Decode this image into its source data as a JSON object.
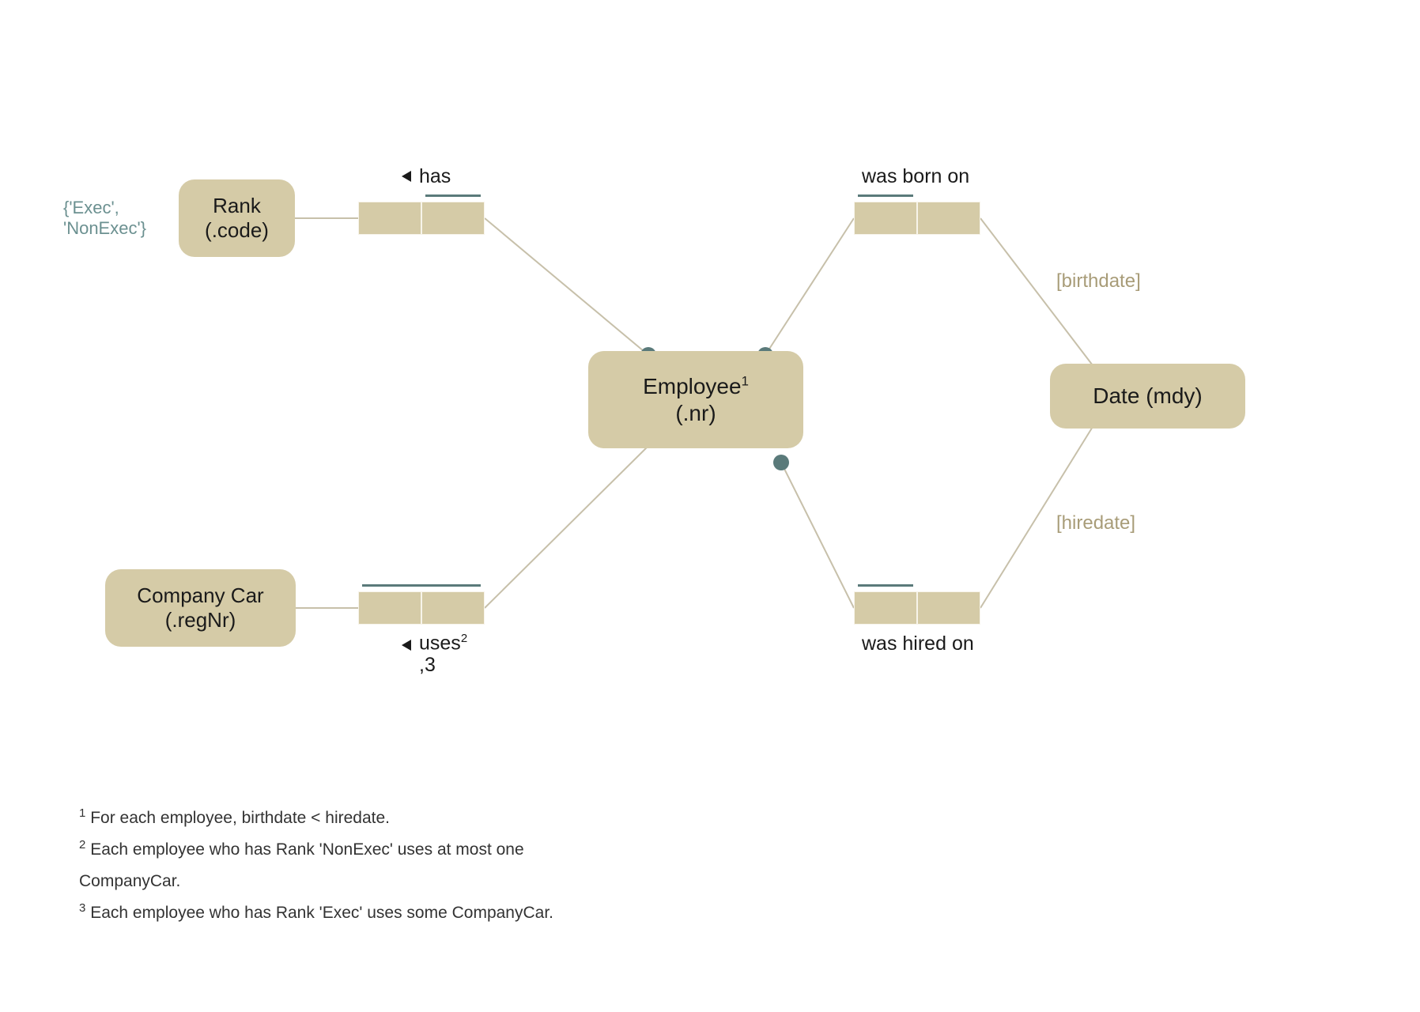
{
  "entities": {
    "rank": {
      "line1": "Rank",
      "line2": "(.code)"
    },
    "companyCar": {
      "line1": "Company Car",
      "line2": "(.regNr)"
    },
    "employee": {
      "line1": "Employee",
      "sup": "1",
      "line2": "(.nr)"
    },
    "date": {
      "line1": "Date (mdy)"
    }
  },
  "predicates": {
    "has": "has",
    "uses": "uses",
    "usesSup": "2",
    "usesLine2": ",3",
    "wasBornOn": "was born on",
    "wasHiredOn": "was hired on"
  },
  "roleNames": {
    "birthdate": "[birthdate]",
    "hiredate": "[hiredate]"
  },
  "constraints": {
    "rankValues": "{'Exec',\n'NonExec'}"
  },
  "footnotes": {
    "n1": "For each employee, birthdate < hiredate.",
    "n2": "Each employee who has Rank 'NonExec' uses at most one CompanyCar.",
    "n3": "Each employee who has Rank 'Exec' uses some CompanyCar."
  }
}
